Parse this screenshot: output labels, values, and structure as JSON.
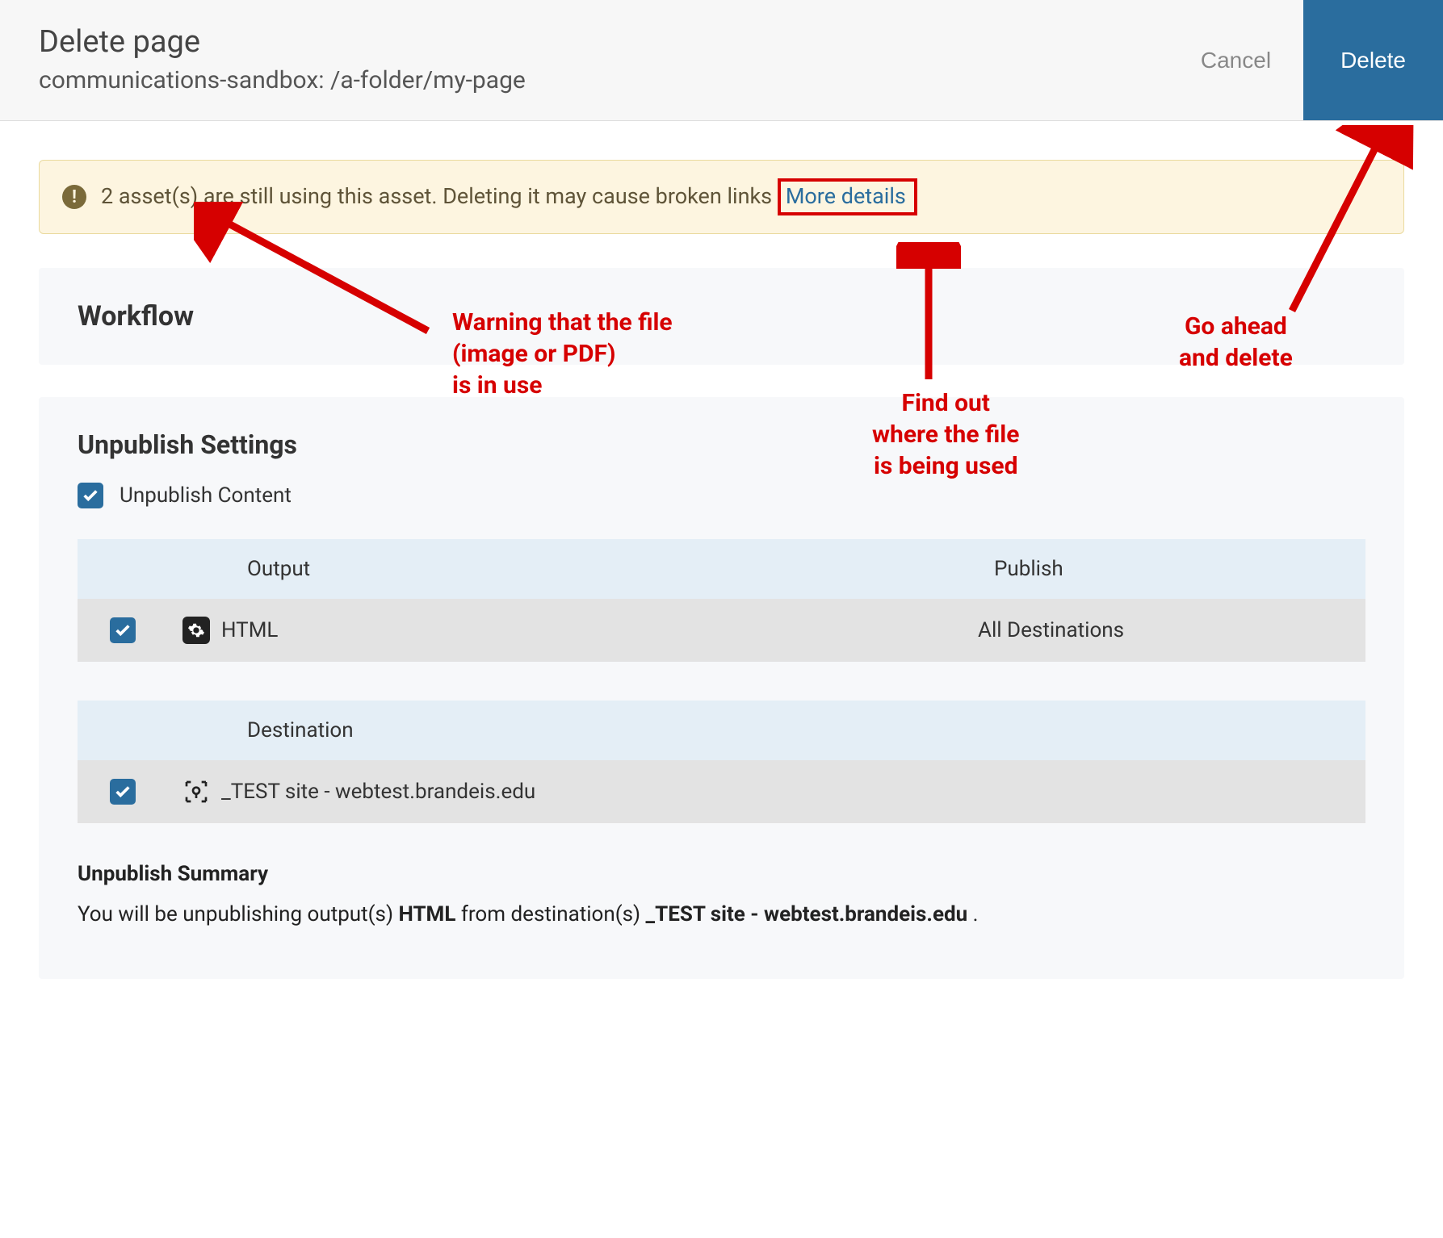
{
  "header": {
    "title": "Delete page",
    "subtitle": "communications-sandbox: /a-folder/my-page",
    "cancel": "Cancel",
    "delete": "Delete"
  },
  "warning": {
    "icon_label": "!",
    "text": "2 asset(s) are still using this asset. Deleting it may cause broken links",
    "more": "More details"
  },
  "workflow": {
    "title": "Workflow"
  },
  "unpublish": {
    "title": "Unpublish Settings",
    "checkbox_label": "Unpublish Content",
    "output_header": "Output",
    "publish_header": "Publish",
    "output_row": {
      "label": "HTML",
      "publish": "All Destinations"
    },
    "destination_header": "Destination",
    "destination_row": {
      "label": "_TEST site - webtest.brandeis.edu"
    },
    "summary_title": "Unpublish Summary",
    "summary_prefix": "You will be unpublishing output(s) ",
    "summary_output": "HTML",
    "summary_mid": " from destination(s) ",
    "summary_dest": "_TEST site - webtest.brandeis.edu",
    "summary_suffix": " ."
  },
  "annotations": {
    "warn_label": "Warning that the file\n(image or PDF)\nis in use",
    "details_label": "Find out\nwhere the file\nis being used",
    "delete_label": "Go ahead\nand delete"
  },
  "colors": {
    "accent": "#2a6d9e",
    "warning_bg": "#fdf5e0",
    "warning_border": "#eada9e",
    "anno": "#d60000"
  }
}
